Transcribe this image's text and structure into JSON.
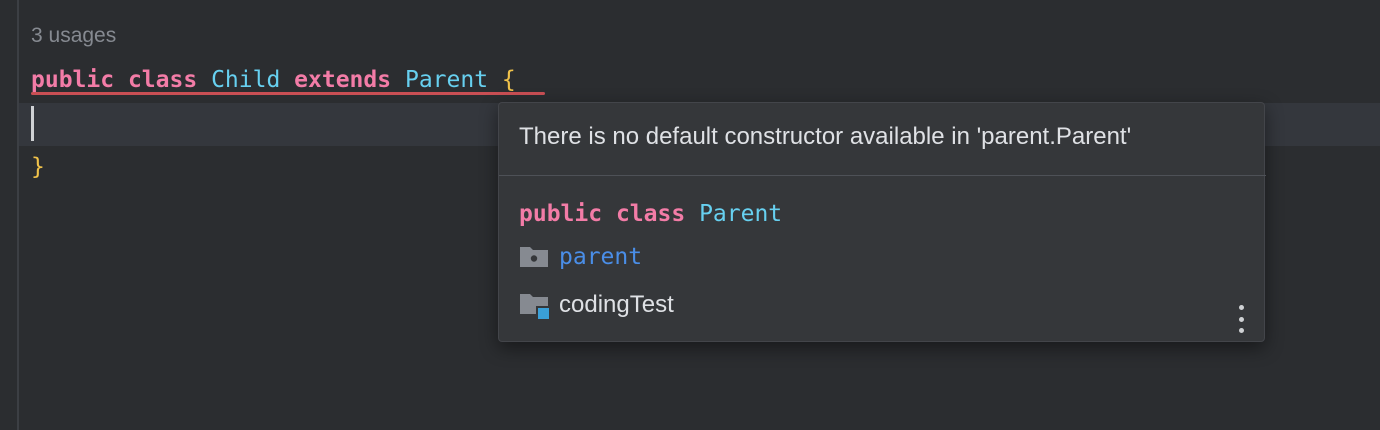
{
  "editor": {
    "usages_hint": "3 usages",
    "line1": {
      "kw_public": "public",
      "kw_class": "class",
      "class_name": "Child",
      "kw_extends": "extends",
      "parent_name": "Parent",
      "open_brace": "{"
    },
    "close_brace": "}"
  },
  "popup": {
    "message": "There is no default constructor available in 'parent.Parent'",
    "declaration": {
      "kw_public": "public",
      "kw_class": "class",
      "class_name": "Parent"
    },
    "package": {
      "icon": "package-folder-icon",
      "name": "parent"
    },
    "module": {
      "icon": "module-folder-icon",
      "name": "codingTest"
    },
    "more_icon": "more-vertical-icon"
  },
  "colors": {
    "keyword": "#f37ca7",
    "type": "#67d0f0",
    "brace": "#f0c24a",
    "error_underline": "#c94f54",
    "link": "#4a8ee8",
    "background": "#2b2d30",
    "popup_background": "#35373a"
  }
}
